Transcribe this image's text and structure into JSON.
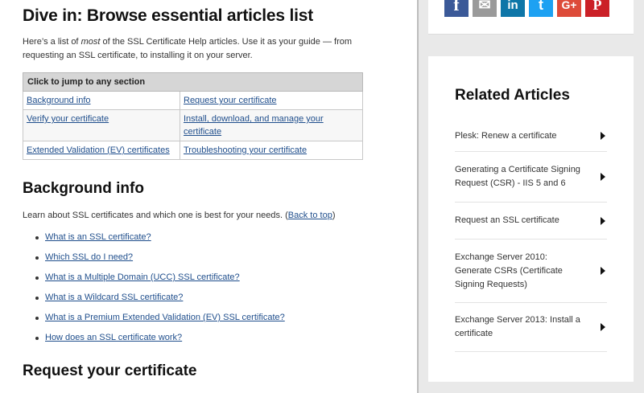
{
  "main": {
    "title": "Dive in: Browse essential articles list",
    "intro_before": "Here’s a list of ",
    "intro_em": "most",
    "intro_after": " of the SSL Certificate Help articles. Use it as your guide — from requesting an SSL certificate, to installing it on your server.",
    "jump_table": {
      "header": "Click to jump to any section",
      "rows": [
        [
          "Background info",
          "Request your certificate"
        ],
        [
          "Verify your certificate",
          "Install, download, and manage your certificate"
        ],
        [
          "Extended Validation (EV) certificates",
          "Troubleshooting your certificate"
        ]
      ]
    },
    "background": {
      "heading": "Background info",
      "text": "Learn about SSL certificates and which one is best for your needs. (",
      "back_link": "Back to top",
      "text_end": ")",
      "links": [
        "What is an SSL certificate?",
        "Which SSL do I need?",
        "What is a Multiple Domain (UCC) SSL certificate?",
        "What is a Wildcard SSL certificate?",
        "What is a Premium Extended Validation (EV) SSL certificate?",
        "How does an SSL certificate work?"
      ]
    },
    "request_heading": "Request your certificate"
  },
  "share": {
    "icons": [
      {
        "name": "facebook-icon",
        "glyph": "f",
        "color": "#3b5998"
      },
      {
        "name": "email-icon",
        "glyph": "✉",
        "color": "#9a9a9a"
      },
      {
        "name": "linkedin-icon",
        "glyph": "in",
        "color": "#0e76a8"
      },
      {
        "name": "twitter-icon",
        "glyph": "t",
        "color": "#1da1f2"
      },
      {
        "name": "googleplus-icon",
        "glyph": "G+",
        "color": "#dd4b39"
      },
      {
        "name": "pinterest-icon",
        "glyph": "P",
        "color": "#cb2027"
      }
    ]
  },
  "related": {
    "heading": "Related Articles",
    "items": [
      "Plesk: Renew a certificate",
      "Generating a Certificate Signing Request (CSR) - IIS 5 and 6",
      "Request an SSL certificate",
      "Exchange Server 2010: Generate CSRs (Certificate Signing Requests)",
      "Exchange Server 2013: Install a certificate"
    ]
  }
}
